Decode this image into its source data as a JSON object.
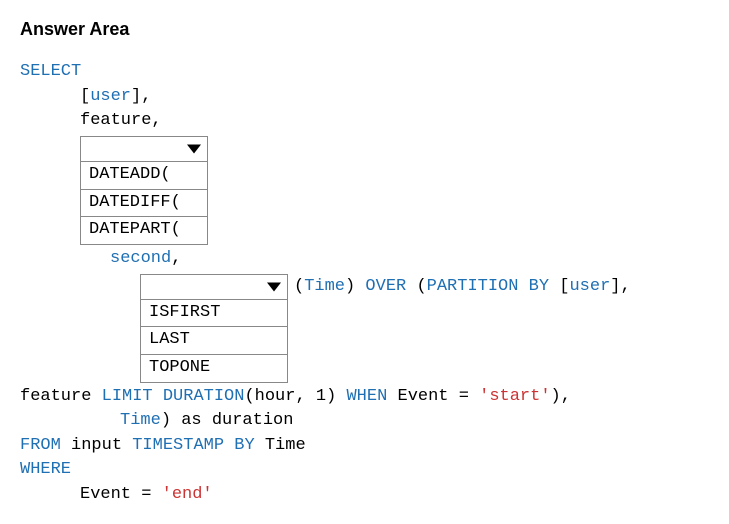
{
  "title": "Answer Area",
  "code": {
    "select_kw": "SELECT",
    "user_open": "[",
    "user_word": "user",
    "user_close": "]",
    "comma": ",",
    "feature_word": "feature,",
    "dropdown1_options": {
      "o1": "DATEADD(",
      "o2": "DATEDIFF(",
      "o3": "DATEPART("
    },
    "second_word": "second",
    "dropdown2_options": {
      "o1": "ISFIRST",
      "o2": "LAST",
      "o3": "TOPONE"
    },
    "after_drop2": {
      "open_paren": "(",
      "time_word": "Time",
      "close_paren": ")",
      "over_kw": " OVER ",
      "open_paren2": "(",
      "partition_kw": "PARTITION BY",
      "sp": " ",
      "user_open2": "[",
      "user_word2": "user",
      "user_close_comma": "],"
    },
    "line_feature_limit": {
      "feature": "feature ",
      "limit": "LIMIT DURATION",
      "hour_part": "(hour, 1) ",
      "when_kw": "WHEN",
      "event_eq": " Event = ",
      "start_lit": "'start'",
      "close": "),"
    },
    "line_time_as": {
      "time_word": "Time",
      "rest": ") as duration"
    },
    "from_line": {
      "from_kw": "FROM",
      "input_word": " input ",
      "ts_by_kw": "TIMESTAMP BY",
      "time_word": " Time"
    },
    "where_kw": "WHERE",
    "event_eq2": "Event = ",
    "end_lit": "'end'"
  }
}
